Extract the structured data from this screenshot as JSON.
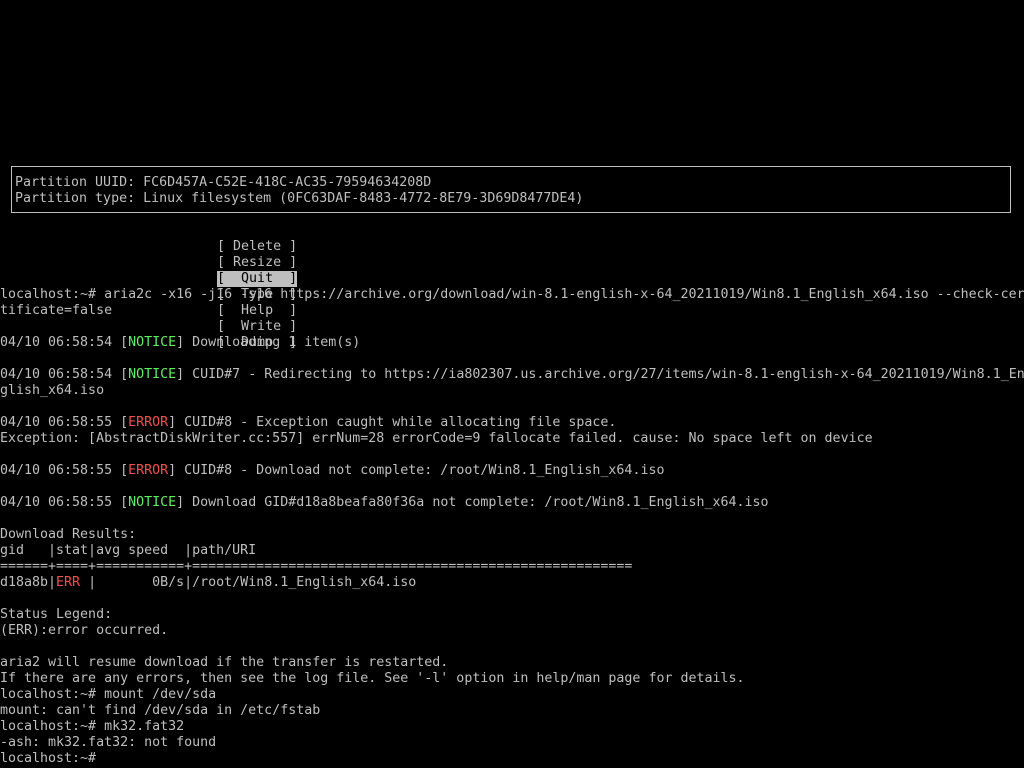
{
  "partition": {
    "uuid_line": "Partition UUID: FC6D457A-C52E-418C-AC35-79594634208D",
    "type_line": "Partition type: Linux filesystem (0FC63DAF-8483-4772-8E79-3D69D8477DE4)"
  },
  "menu": {
    "delete": "[ Delete ]",
    "resize": "[ Resize ]",
    "quit": "[  Quit  ]",
    "type": "[  Type  ]",
    "help": "[  Help  ]",
    "write": "[  Write ]",
    "dump": "[  Dump  ]"
  },
  "output": {
    "l1": "localhost:~# aria2c -x16 -j16 -s16 https://archive.org/download/win-8.1-english-x-64_20211019/Win8.1_English_x64.iso --check-cer",
    "l2": "tificate=false",
    "n1_pre": "04/10 06:58:54 [",
    "n1_tag": "NOTICE",
    "n1_post": "] Downloading 1 item(s)",
    "n2_pre": "04/10 06:58:54 [",
    "n2_tag": "NOTICE",
    "n2_post": "] CUID#7 - Redirecting to https://ia802307.us.archive.org/27/items/win-8.1-english-x-64_20211019/Win8.1_En",
    "n2_cont": "glish_x64.iso",
    "e1_pre": "04/10 06:58:55 [",
    "e1_tag": "ERROR",
    "e1_post": "] CUID#8 - Exception caught while allocating file space.",
    "e1_cont": "Exception: [AbstractDiskWriter.cc:557] errNum=28 errorCode=9 fallocate failed. cause: No space left on device",
    "e2_pre": "04/10 06:58:55 [",
    "e2_tag": "ERROR",
    "e2_post": "] CUID#8 - Download not complete: /root/Win8.1_English_x64.iso",
    "n3_pre": "04/10 06:58:55 [",
    "n3_tag": "NOTICE",
    "n3_post": "] Download GID#d18a8beafa80f36a not complete: /root/Win8.1_English_x64.iso",
    "results_title": "Download Results:",
    "results_header": "gid   |stat|avg speed  |path/URI",
    "results_sep": "======+====+===========+=======================================================",
    "row_gid": "d18a8b|",
    "row_stat": "ERR",
    "row_rest": " |       0B/s|/root/Win8.1_English_x64.iso",
    "legend_title": "Status Legend:",
    "legend_err": "(ERR):error occurred.",
    "resume": "aria2 will resume download if the transfer is restarted.",
    "errors_hint": "If there are any errors, then see the log file. See '-l' option in help/man page for details.",
    "cmd_mount": "localhost:~# mount /dev/sda",
    "mount_err": "mount: can't find /dev/sda in /etc/fstab",
    "cmd_mk": "localhost:~# mk32.fat32",
    "mk_err": "-ash: mk32.fat32: not found",
    "prompt": "localhost:~#"
  },
  "colors": {
    "notice": "#5ff05f",
    "error": "#f05050",
    "text": "#bfbfbf",
    "background": "#000000"
  }
}
